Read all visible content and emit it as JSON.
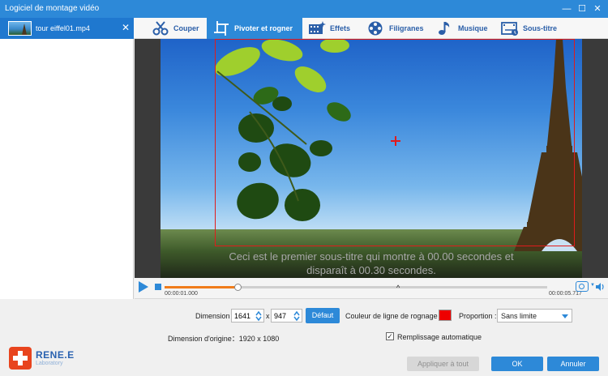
{
  "window": {
    "title": "Logiciel de montage vidéo",
    "controls": [
      "―",
      "☐",
      "✕"
    ]
  },
  "file_list": {
    "items": [
      {
        "name": "tour eiffel01.mp4",
        "close": "✕"
      }
    ]
  },
  "tabs": [
    {
      "label": "Couper",
      "icon": "scissors-icon",
      "active": false
    },
    {
      "label": "Pivoter et rogner",
      "icon": "crop-rotate-icon",
      "active": true
    },
    {
      "label": "Effets",
      "icon": "film-effects-icon",
      "active": false
    },
    {
      "label": "Filigranes",
      "icon": "film-reel-icon",
      "active": false
    },
    {
      "label": "Musique",
      "icon": "music-note-icon",
      "active": false
    },
    {
      "label": "Sous-titre",
      "icon": "subtitle-icon",
      "active": false
    }
  ],
  "preview": {
    "subtitle_text": "Ceci est le premier sous-titre qui montre à 00.00 secondes et\ndisparaît à 00.30 secondes."
  },
  "player": {
    "current_time": "00:00:01.000",
    "total_time": "00:00:05.717",
    "progress": 0.19,
    "chevron": "^"
  },
  "crop": {
    "dimension_label": "Dimension :",
    "width": "1641",
    "x_separator": "x",
    "height": "947",
    "default_button": "Défaut",
    "line_color_label": "Couleur de ligne de rognage :",
    "line_color": "#ee0000",
    "ratio_label": "Proportion :",
    "ratio_value": "Sans limite",
    "original_dimension": "Dimension d'origine：1920 x 1080",
    "auto_fill_label": "Remplissage automatique",
    "auto_fill_checked": "✓"
  },
  "brand": {
    "name": "RENE.E",
    "sub": "Laboratory"
  },
  "footer": {
    "apply_all": "Appliquer à tout",
    "ok": "OK",
    "cancel": "Annuler"
  },
  "colors": {
    "accent": "#2d89d8",
    "progress": "#f07c1a",
    "crop_line": "#e11b1b"
  }
}
